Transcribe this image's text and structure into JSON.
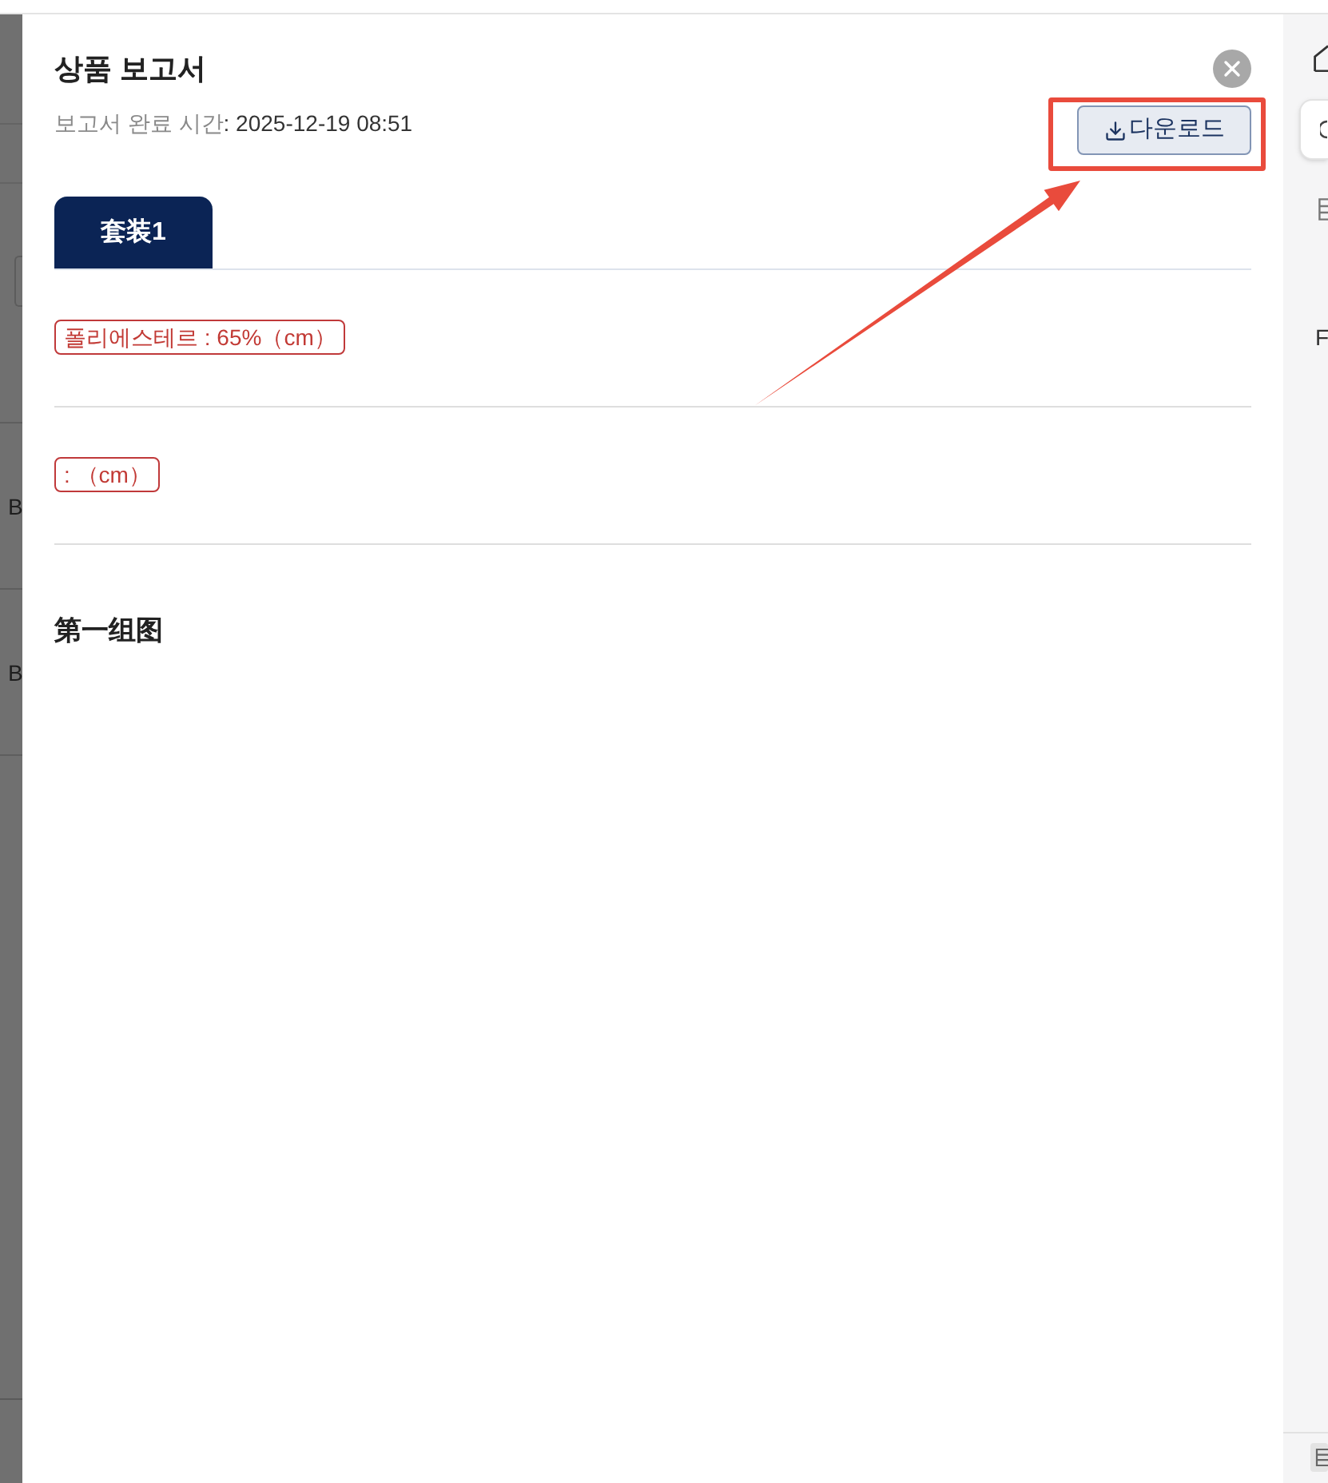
{
  "header": {
    "title": "상품 보고서",
    "completed_label": "보고서 완료 시간",
    "completed_value": ": 2025-12-19 08:51"
  },
  "download_button": {
    "label": "다운로드"
  },
  "tabs": [
    {
      "label": "套装1",
      "selected": true
    }
  ],
  "tags": [
    {
      "text": "폴리에스테르 : 65%（cm）"
    },
    {
      "text": ": （cm）"
    }
  ],
  "section_heading": "第一组图",
  "background_left": {
    "texts": [
      "B",
      "B"
    ]
  },
  "background_right": {
    "texts": [
      "F"
    ]
  }
}
